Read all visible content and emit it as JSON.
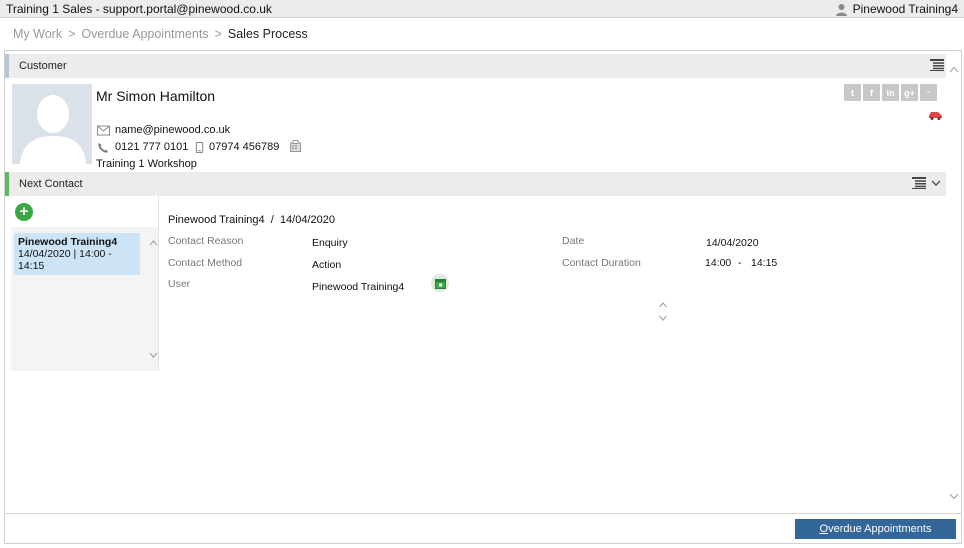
{
  "window": {
    "title": "Training 1 Sales - support.portal@pinewood.co.uk",
    "user": "Pinewood Training4"
  },
  "breadcrumb": {
    "items": [
      "My Work",
      "Overdue Appointments",
      "Sales Process"
    ],
    "separator": ">"
  },
  "customer": {
    "section_label": "Customer",
    "name": "Mr Simon Hamilton",
    "email": "name@pinewood.co.uk",
    "phone": "0121 777 0101",
    "mobile": "07974 456789",
    "site": "Training 1 Workshop",
    "social_icons": [
      "twitter-icon",
      "facebook-icon",
      "linkedin-icon",
      "googleplus-icon",
      "other-social-icon"
    ]
  },
  "next_contact": {
    "section_label": "Next Contact",
    "list": [
      {
        "name": "Pinewood Training4",
        "date_time": "14/04/2020 | 14:00 - 14:15"
      }
    ],
    "detail": {
      "header_user": "Pinewood Training4",
      "header_sep": "/",
      "header_date": "14/04/2020",
      "contact_reason_label": "Contact Reason",
      "contact_reason": "Enquiry",
      "contact_method_label": "Contact Method",
      "contact_method": "Action",
      "user_label": "User",
      "user": "Pinewood Training4",
      "date_label": "Date",
      "date": "14/04/2020",
      "duration_label": "Contact Duration",
      "duration_start": "14:00",
      "duration_sep": "-",
      "duration_end": "14:15"
    }
  },
  "footer": {
    "button_label_first": "O",
    "button_label_rest": "verdue Appointments"
  },
  "colors": {
    "accent": "#336699",
    "selected_row": "#cde4f7",
    "add_button": "#3aa845",
    "next_contact_bar": "#5cb85c"
  }
}
